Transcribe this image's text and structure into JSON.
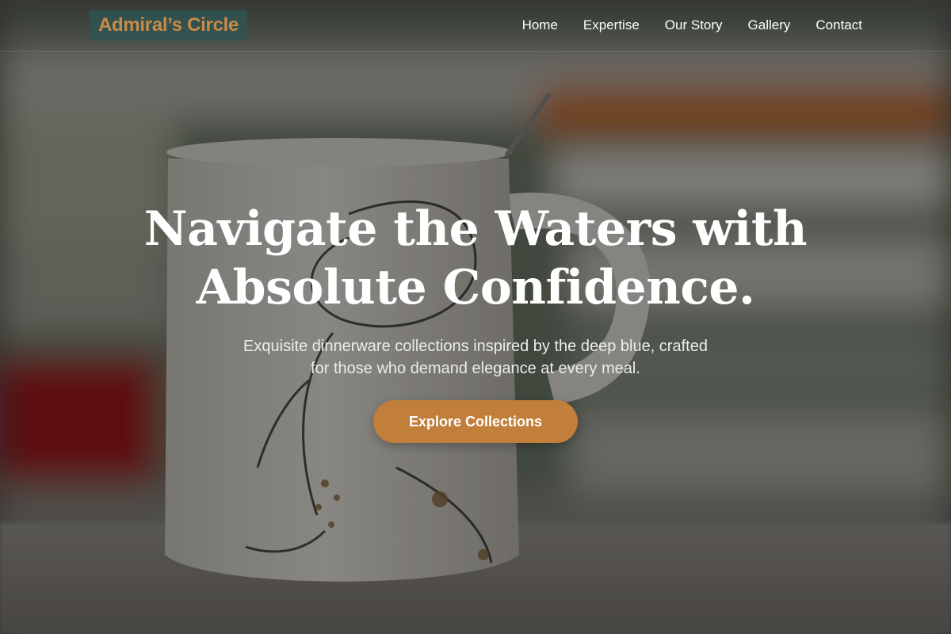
{
  "brand": {
    "logo_text": "Admiral’s Circle",
    "logo_color": "#c88a47",
    "logo_bg": "#2d5555"
  },
  "nav": {
    "items": [
      {
        "label": "Home"
      },
      {
        "label": "Expertise"
      },
      {
        "label": "Our Story"
      },
      {
        "label": "Gallery"
      },
      {
        "label": "Contact"
      }
    ]
  },
  "hero": {
    "headline_line1": "Navigate the Waters with",
    "headline_line2": "Absolute Confidence.",
    "subtitle_line1": "Exquisite dinnerware collections inspired by the deep blue, crafted",
    "subtitle_line2": "for those who demand elegance at every meal.",
    "cta_label": "Explore Collections",
    "cta_color": "#c27e3b"
  }
}
